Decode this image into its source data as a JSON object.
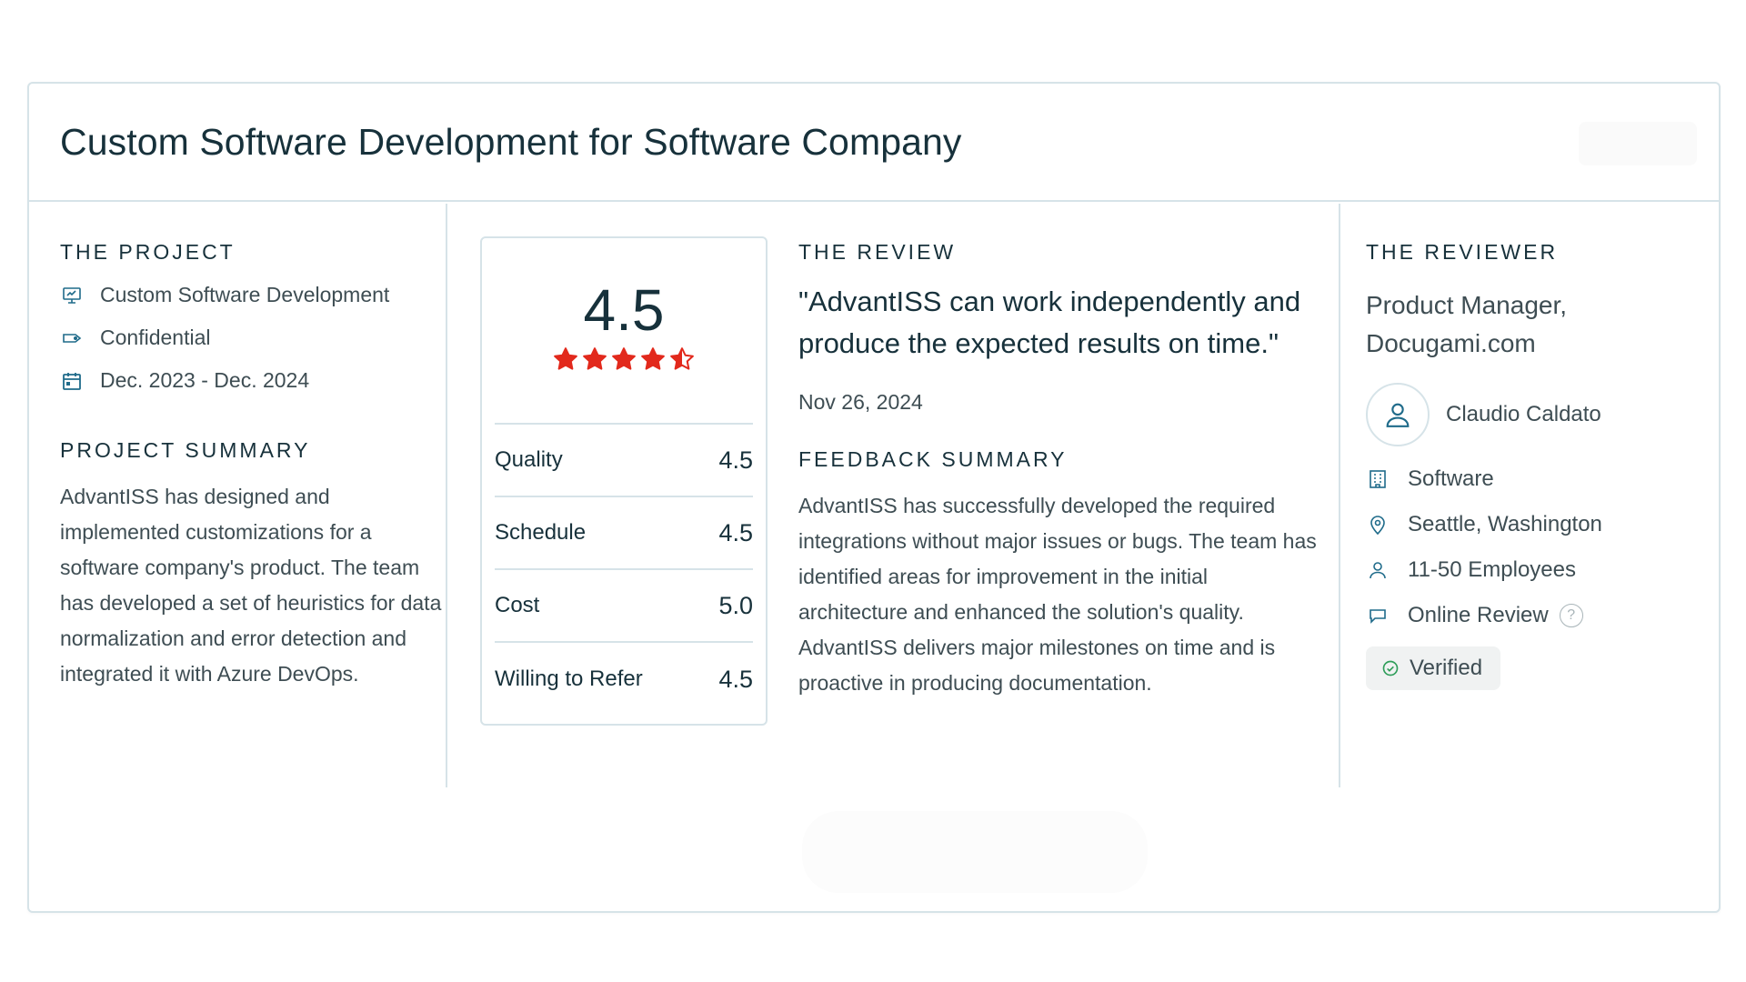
{
  "header": {
    "title": "Custom Software Development for Software Company"
  },
  "project": {
    "section_label": "THE PROJECT",
    "service": "Custom Software Development",
    "budget": "Confidential",
    "dates": "Dec. 2023 - Dec. 2024",
    "summary_label": "PROJECT SUMMARY",
    "summary": "AdvantISS has designed and implemented customizations for a software company's product. The team has developed a set of heuristics for data normalization and error detection and integrated it with Azure DevOps."
  },
  "rating": {
    "overall": "4.5",
    "overall_value": 4.5,
    "star_color": "#e2291c",
    "rows": [
      {
        "label": "Quality",
        "value": "4.5"
      },
      {
        "label": "Schedule",
        "value": "4.5"
      },
      {
        "label": "Cost",
        "value": "5.0"
      },
      {
        "label": "Willing to Refer",
        "value": "4.5"
      }
    ]
  },
  "review": {
    "section_label": "THE REVIEW",
    "quote": "\"AdvantISS can work independently and produce the expected results on time.\"",
    "date": "Nov 26, 2024",
    "feedback_label": "FEEDBACK SUMMARY",
    "feedback": "AdvantISS has successfully developed the required integrations without major issues or bugs. The team has identified areas for improvement in the initial architecture and enhanced the solution's quality. AdvantISS delivers major milestones on time and is proactive in producing documentation."
  },
  "reviewer": {
    "section_label": "THE REVIEWER",
    "role": "Product Manager, Docugami.com",
    "name": "Claudio Caldato",
    "industry": "Software",
    "location": "Seattle, Washington",
    "size": "11-50 Employees",
    "review_type": "Online Review",
    "help_glyph": "?",
    "verified": "Verified"
  },
  "colors": {
    "accent_icon": "#1f6b8a",
    "text": "#17313b",
    "muted": "#3e4d53",
    "border": "#d6e3e8"
  }
}
